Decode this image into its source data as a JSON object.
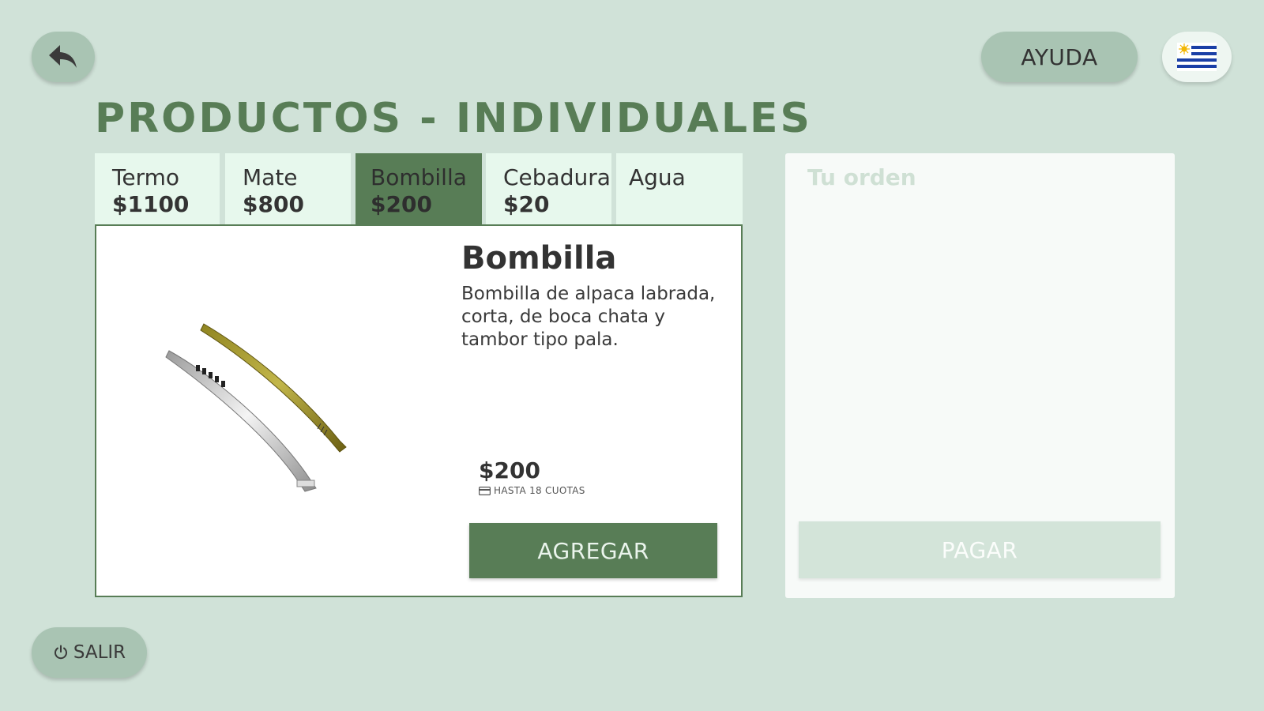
{
  "header": {
    "back_icon": "reply-arrow-icon",
    "help_label": "AYUDA",
    "language_icon": "uruguay-flag-icon"
  },
  "page": {
    "title": "PRODUCTOS - INDIVIDUALES"
  },
  "tabs": [
    {
      "name": "Termo",
      "price": "$1100",
      "active": false
    },
    {
      "name": "Mate",
      "price": "$800",
      "active": false
    },
    {
      "name": "Bombilla",
      "price": "$200",
      "active": true
    },
    {
      "name": "Cebadura",
      "price": "$20",
      "active": false
    },
    {
      "name": "Agua",
      "price": "",
      "active": false
    }
  ],
  "product": {
    "name": "Bombilla",
    "description": "Bombilla de alpaca labrada, corta, de boca chata y tambor tipo pala.",
    "price": "$200",
    "installments": "HASTA 18 CUOTAS",
    "installments_icon": "credit-card-icon",
    "add_label": "AGREGAR"
  },
  "order": {
    "title": "Tu orden",
    "pay_label": "PAGAR"
  },
  "footer": {
    "exit_label": "SALIR",
    "exit_icon": "power-icon"
  },
  "colors": {
    "background": "#d0e2d8",
    "accent": "#587d56",
    "tab_bg": "#e7f8ed",
    "pill_button": "#a9c4b3"
  }
}
